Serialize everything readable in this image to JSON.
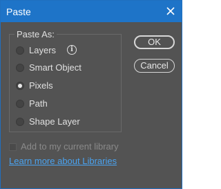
{
  "window": {
    "title": "Paste",
    "accent_color": "#1e74c8"
  },
  "paste_as": {
    "group_label": "Paste As:",
    "options": [
      {
        "label": "Layers",
        "selected": false
      },
      {
        "label": "Smart Object",
        "selected": false
      },
      {
        "label": "Pixels",
        "selected": true
      },
      {
        "label": "Path",
        "selected": false
      },
      {
        "label": "Shape Layer",
        "selected": false
      }
    ],
    "info_icon": "i"
  },
  "buttons": {
    "ok": "OK",
    "cancel": "Cancel"
  },
  "library": {
    "checkbox_label": "Add to my current library",
    "checked": false,
    "enabled": false
  },
  "link": {
    "text": "Learn more about Libraries",
    "color": "#4aa3f0"
  }
}
